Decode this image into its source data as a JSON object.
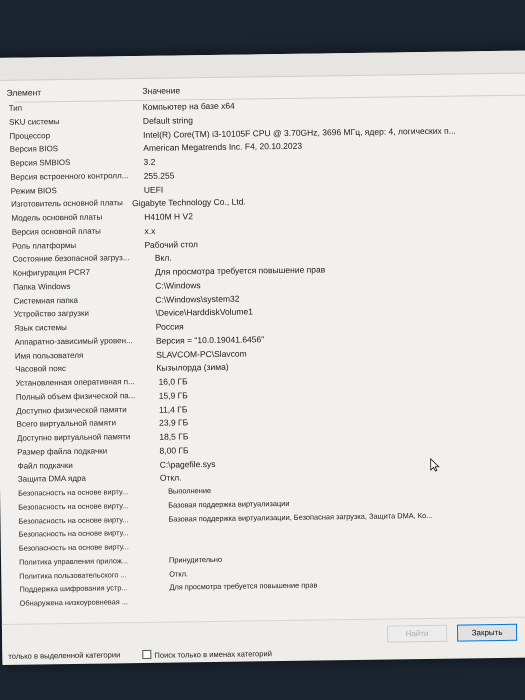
{
  "table": {
    "col_item": "Элемент",
    "col_value": "Значение",
    "rows": [
      {
        "k": "Тип",
        "v": "Компьютер на базе x64"
      },
      {
        "k": "SKU системы",
        "v": "Default string"
      },
      {
        "k": "Процессор",
        "v": "Intel(R) Core(TM) i3-10105F CPU @ 3.70GHz, 3696 МГц, ядер: 4, логических п..."
      },
      {
        "k": "Версия BIOS",
        "v": "American Megatrends Inc. F4, 20.10.2023"
      },
      {
        "k": "Версия SMBIOS",
        "v": "3.2"
      },
      {
        "k": "Версия встроенного контролл...",
        "v": "255.255"
      },
      {
        "k": "Режим BIOS",
        "v": "UEFI"
      },
      {
        "k": "Изготовитель основной платы",
        "v": "Gigabyte Technology Co., Ltd."
      },
      {
        "k": "Модель основной платы",
        "v": "H410M H V2"
      },
      {
        "k": "Версия основной платы",
        "v": "x.x"
      },
      {
        "k": "Роль платформы",
        "v": "Рабочий стол"
      },
      {
        "k": "Состояние безопасной загруз...",
        "v": "Вкл."
      },
      {
        "k": "Конфигурация PCR7",
        "v": "Для просмотра требуется повышение прав"
      },
      {
        "k": "Папка Windows",
        "v": "C:\\Windows"
      },
      {
        "k": "Системная папка",
        "v": "C:\\Windows\\system32"
      },
      {
        "k": "Устройство загрузки",
        "v": "\\Device\\HarddiskVolume1"
      },
      {
        "k": "Язык системы",
        "v": "Россия"
      },
      {
        "k": "Аппаратно-зависимый уровен...",
        "v": "Версия = \"10.0.19041.6456\""
      },
      {
        "k": "Имя пользователя",
        "v": "SLAVCOM-PC\\Slavcom"
      },
      {
        "k": "Часовой пояс",
        "v": "Кызылорда (зима)"
      },
      {
        "k": "Установленная оперативная п...",
        "v": "16,0 ГБ"
      },
      {
        "k": "Полный объем физической па...",
        "v": "15,9 ГБ"
      },
      {
        "k": "Доступно физической памяти",
        "v": "11,4 ГБ"
      },
      {
        "k": "Всего виртуальной памяти",
        "v": "23,9 ГБ"
      },
      {
        "k": "Доступно виртуальной памяти",
        "v": "18,5 ГБ"
      },
      {
        "k": "Размер файла подкачки",
        "v": "8,00 ГБ"
      },
      {
        "k": "Файл подкачки",
        "v": "C:\\pagefile.sys"
      },
      {
        "k": "Защита DMA ядра",
        "v": "Откл."
      },
      {
        "k": "Безопасность на основе вирту...",
        "v": "Выполнение"
      },
      {
        "k": "Безопасность на основе вирту...",
        "v": "Базовая поддержка виртуализации"
      },
      {
        "k": "Безопасность на основе вирту...",
        "v": "Базовая поддержка виртуализации, Безопасная загрузка, Защита DMA, Ко..."
      },
      {
        "k": "Безопасность на основе вирту...",
        "v": ""
      },
      {
        "k": "Безопасность на основе вирту...",
        "v": ""
      },
      {
        "k": "Политика управления прилож...",
        "v": "Принудительно"
      },
      {
        "k": "Политика пользовательского ...",
        "v": "Откл."
      },
      {
        "k": "Поддержка шифрования устр...",
        "v": "Для просмотра требуется повышение прав"
      },
      {
        "k": "Обнаружена низкоуровневая ...",
        "v": ""
      }
    ]
  },
  "buttons": {
    "find": "Найти",
    "close": "Закрыть"
  },
  "options": {
    "only_selected_category": "только в выделенной категории",
    "search_names_only": "Поиск только в именах категорий"
  }
}
